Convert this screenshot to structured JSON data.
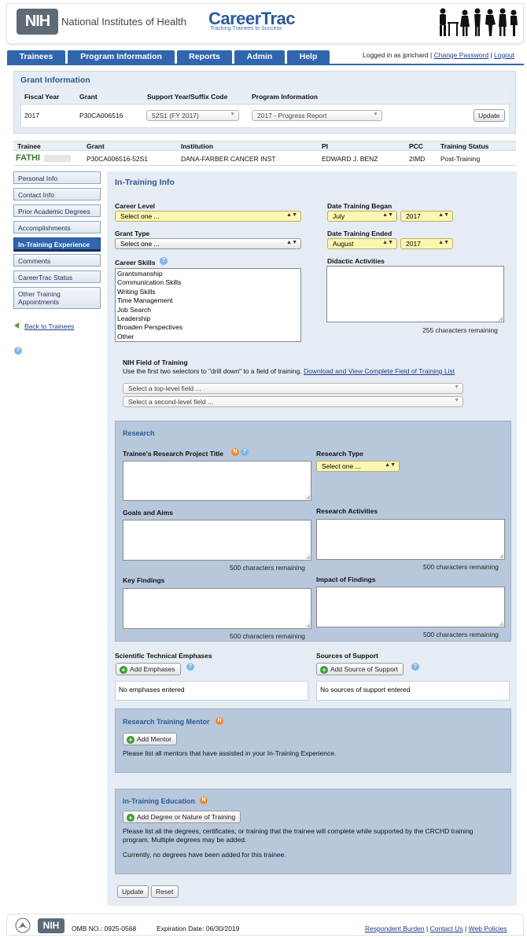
{
  "header": {
    "nih_logo": "NIH",
    "nih_name": "National Institutes of Health",
    "app_name": "CareerTrac",
    "app_tagline": "Tracking Trainees to Success"
  },
  "nav": {
    "tabs": [
      "Trainees",
      "Program Information",
      "Reports",
      "Admin",
      "Help"
    ],
    "logged_in": "Logged in as jprichard",
    "change_password": "Change Password",
    "logout": "Logout",
    "sep": "|"
  },
  "grant_info": {
    "title": "Grant Information",
    "headers": [
      "Fiscal Year",
      "Grant",
      "Support Year/Suffix Code",
      "Program Information"
    ],
    "fiscal_year": "2017",
    "grant": "P30CA006516",
    "support_year": "52S1 (FY 2017)",
    "program_info": "2017 - Progress Report",
    "update_label": "Update"
  },
  "trainee": {
    "headers": [
      "Trainee",
      "Grant",
      "Institution",
      "PI",
      "PCC",
      "Training Status"
    ],
    "name": "FATHI",
    "grant": "P30CA006516-52S1",
    "institution": "DANA-FARBER CANCER INST",
    "pi": "EDWARD J. BENZ",
    "pcc": "2IMD",
    "status": "Post-Training"
  },
  "sidebar": {
    "items": [
      "Personal Info",
      "Contact Info",
      "Prior Academic Degrees",
      "Accomplishments",
      "In-Training Experience",
      "Comments",
      "CareerTrac Status",
      "Other Training Appointments"
    ],
    "back_link": "Back to Trainees"
  },
  "form": {
    "title": "In-Training Info",
    "career_level_label": "Career Level",
    "career_level_value": "Select one ...",
    "grant_type_label": "Grant Type",
    "grant_type_value": "Select one ...",
    "career_skills_label": "Career Skills",
    "career_skills": [
      "Grantsmanship",
      "Communication Skills",
      "Writing Skills",
      "Time Management",
      "Job Search",
      "Leadership",
      "Broaden Perspectives",
      "Other"
    ],
    "date_began_label": "Date Training Began",
    "date_began_month": "July",
    "date_began_year": "2017",
    "date_ended_label": "Date Training Ended",
    "date_ended_month": "August",
    "date_ended_year": "2017",
    "didactic_label": "Didactic Activities",
    "didactic_remaining": "255 characters remaining",
    "field_label": "NIH Field of Training",
    "field_hint": "Use the first two selectors to \"drill down\" to a field of training.",
    "field_link": "Download and View Complete Field of Training List",
    "top_level_placeholder": "Select a top-level field ...",
    "second_level_placeholder": "Select a second-level field ..."
  },
  "research": {
    "title": "Research",
    "project_title_label": "Trainee's Research Project Title",
    "research_type_label": "Research Type",
    "research_type_value": "Select one ...",
    "goals_label": "Goals and Aims",
    "activities_label": "Research Activities",
    "findings_label": "Key Findings",
    "impact_label": "Impact of Findings",
    "remaining": "500 characters remaining"
  },
  "emphases": {
    "label": "Scientific Technical Emphases",
    "add_label": "Add Emphases",
    "empty": "No emphases entered"
  },
  "support": {
    "label": "Sources of Support",
    "add_label": "Add Source of Support",
    "empty": "No sources of support entered"
  },
  "mentor": {
    "title": "Research Training Mentor",
    "add_label": "Add Mentor",
    "note": "Please list all mentors that have assisted in your In-Training Experience."
  },
  "education": {
    "title": "In-Training Education",
    "add_label": "Add Degree or Nature of Training",
    "note1": "Please list all the degrees, certificates, or training that the trainee will complete while supported by the CRCHD training",
    "note2": "program. Multiple degrees may be added.",
    "none": "Currently, no degrees have been added for this trainee."
  },
  "actions": {
    "update": "Update",
    "reset": "Reset"
  },
  "badges": {
    "new": "N",
    "help": "?"
  },
  "footer": {
    "nih_logo": "NIH",
    "omb": "OMB NO.: 0925-0568",
    "expiration": "Expiration Date: 06/30/2019",
    "links": [
      "Respondent Burden",
      "Contact Us",
      "Web Policies"
    ],
    "sep": "|"
  },
  "colors": {
    "tab_blue": "#2f66ad",
    "panel_bg": "#e6ecf3",
    "section_bg": "#b7c8dc",
    "heading_blue": "#2c5a93",
    "select_yellow": "#fbf6b0"
  },
  "icons": [
    "arrow-left-icon",
    "help-icon",
    "new-badge-icon",
    "plus-icon",
    "hhs-eagle-icon",
    "people-silhouette-icon"
  ]
}
